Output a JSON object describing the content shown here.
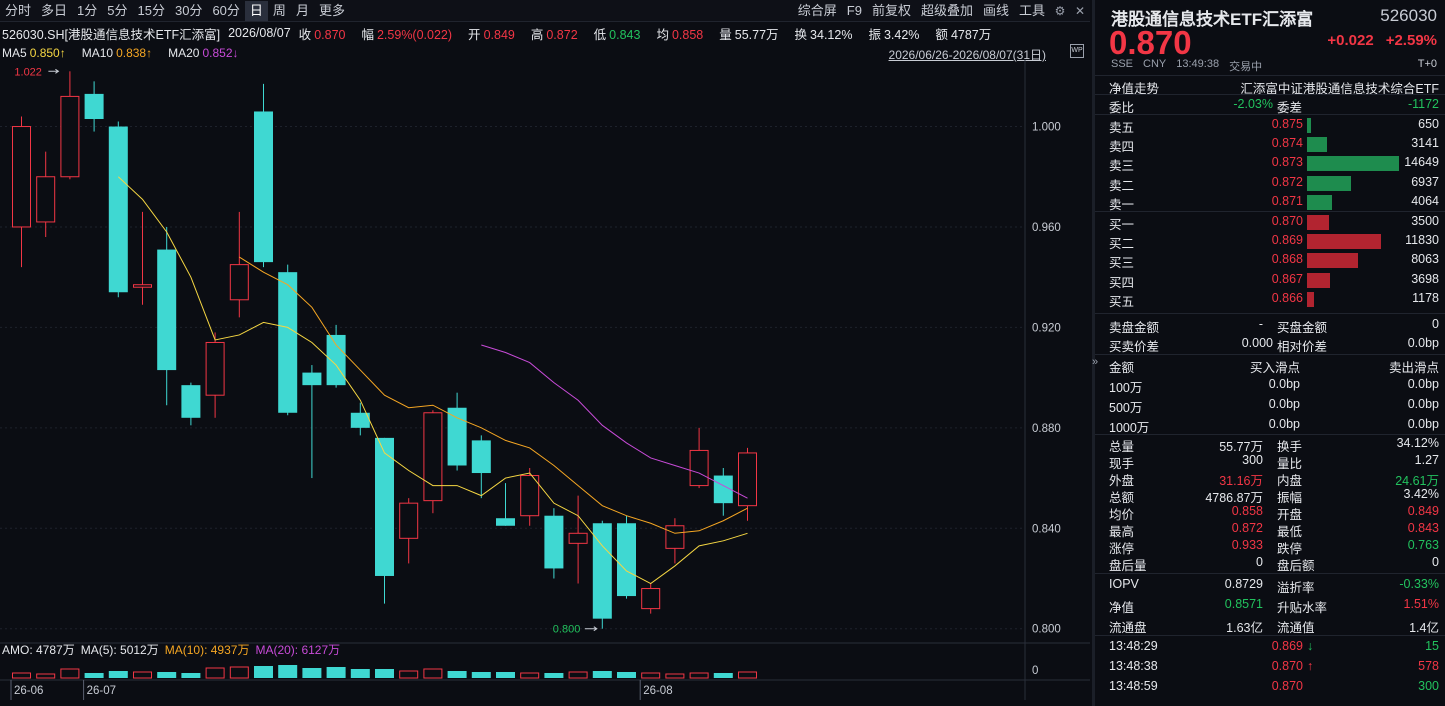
{
  "toolbar": {
    "periods": [
      "分时",
      "多日",
      "1分",
      "5分",
      "15分",
      "30分",
      "60分",
      "日",
      "周",
      "月",
      "更多"
    ],
    "active_index": 7,
    "right_items": [
      "综合屏",
      "F9",
      "前复权",
      "超级叠加",
      "画线",
      "工具"
    ]
  },
  "info": {
    "name": "526030.SH[港股通信息技术ETF汇添富]",
    "date": "2026/08/07",
    "close_label": "收",
    "close": "0.870",
    "range_label": "幅",
    "range": "2.59%(0.022)",
    "open_label": "开",
    "open": "0.849",
    "high_label": "高",
    "high": "0.872",
    "low_label": "低",
    "low": "0.843",
    "avg_label": "均",
    "avg": "0.858",
    "vol_label": "量",
    "vol": "55.77万",
    "turn_label": "换",
    "turn": "34.12%",
    "amp_label": "振",
    "amp": "3.42%",
    "amt_label": "额",
    "amt": "4787万"
  },
  "ma": {
    "ma5_label": "MA5",
    "ma5": "0.850↑",
    "ma10_label": "MA10",
    "ma10": "0.838↑",
    "ma20_label": "MA20",
    "ma20": "0.852↓"
  },
  "date_range": "2026/06/26-2026/08/07(31日)",
  "colors": {
    "up": "#f23645",
    "down": "#3fd8d2",
    "ma5": "#f6d743",
    "ma10": "#f5a623",
    "ma20": "#c84bd8",
    "bg": "#0b0d13",
    "grid": "#1e222c"
  },
  "chart_data": {
    "type": "candlestick",
    "y_ticks": [
      "1.000",
      "0.960",
      "0.920",
      "0.880",
      "0.840",
      "0.800"
    ],
    "y_tick_values": [
      1.0,
      0.96,
      0.92,
      0.88,
      0.84,
      0.8
    ],
    "ylim": [
      0.7955,
      1.0265
    ],
    "x_labels": [
      {
        "label": "26-06",
        "index": 0
      },
      {
        "label": "26-07",
        "index": 3
      },
      {
        "label": "26-08",
        "index": 26
      }
    ],
    "max_label": "1.022",
    "min_label": "0.800",
    "candles": [
      {
        "o": 0.96,
        "c": 1.0,
        "h": 1.004,
        "l": 0.944
      },
      {
        "o": 0.962,
        "c": 0.98,
        "h": 0.99,
        "l": 0.956
      },
      {
        "o": 0.98,
        "c": 1.012,
        "h": 1.022,
        "l": 0.979
      },
      {
        "o": 1.013,
        "c": 1.003,
        "h": 1.018,
        "l": 0.998
      },
      {
        "o": 1.0,
        "c": 0.934,
        "h": 1.002,
        "l": 0.932
      },
      {
        "o": 0.936,
        "c": 0.937,
        "h": 0.966,
        "l": 0.929
      },
      {
        "o": 0.951,
        "c": 0.903,
        "h": 0.96,
        "l": 0.889
      },
      {
        "o": 0.897,
        "c": 0.884,
        "h": 0.898,
        "l": 0.881
      },
      {
        "o": 0.893,
        "c": 0.914,
        "h": 0.918,
        "l": 0.884
      },
      {
        "o": 0.931,
        "c": 0.945,
        "h": 0.966,
        "l": 0.924
      },
      {
        "o": 1.006,
        "c": 0.946,
        "h": 1.017,
        "l": 0.944
      },
      {
        "o": 0.942,
        "c": 0.886,
        "h": 0.945,
        "l": 0.885
      },
      {
        "o": 0.902,
        "c": 0.897,
        "h": 0.905,
        "l": 0.86
      },
      {
        "o": 0.917,
        "c": 0.897,
        "h": 0.921,
        "l": 0.896
      },
      {
        "o": 0.886,
        "c": 0.88,
        "h": 0.89,
        "l": 0.877
      },
      {
        "o": 0.876,
        "c": 0.821,
        "h": 0.876,
        "l": 0.81
      },
      {
        "o": 0.836,
        "c": 0.85,
        "h": 0.852,
        "l": 0.826
      },
      {
        "o": 0.851,
        "c": 0.886,
        "h": 0.887,
        "l": 0.846
      },
      {
        "o": 0.888,
        "c": 0.865,
        "h": 0.894,
        "l": 0.863
      },
      {
        "o": 0.875,
        "c": 0.862,
        "h": 0.877,
        "l": 0.852
      },
      {
        "o": 0.844,
        "c": 0.841,
        "h": 0.858,
        "l": 0.841
      },
      {
        "o": 0.845,
        "c": 0.861,
        "h": 0.864,
        "l": 0.841
      },
      {
        "o": 0.845,
        "c": 0.824,
        "h": 0.848,
        "l": 0.82
      },
      {
        "o": 0.834,
        "c": 0.838,
        "h": 0.853,
        "l": 0.818
      },
      {
        "o": 0.842,
        "c": 0.804,
        "h": 0.843,
        "l": 0.8
      },
      {
        "o": 0.842,
        "c": 0.813,
        "h": 0.845,
        "l": 0.812
      },
      {
        "o": 0.808,
        "c": 0.816,
        "h": 0.818,
        "l": 0.806
      },
      {
        "o": 0.832,
        "c": 0.841,
        "h": 0.844,
        "l": 0.826
      },
      {
        "o": 0.857,
        "c": 0.871,
        "h": 0.88,
        "l": 0.856
      },
      {
        "o": 0.861,
        "c": 0.85,
        "h": 0.864,
        "l": 0.845
      },
      {
        "o": 0.849,
        "c": 0.87,
        "h": 0.872,
        "l": 0.843
      }
    ],
    "ma5": [
      null,
      null,
      null,
      null,
      0.98,
      0.971,
      0.958,
      0.94,
      0.915,
      0.917,
      0.922,
      0.92,
      0.914,
      0.905,
      0.891,
      0.87,
      0.863,
      0.857,
      0.857,
      0.853,
      0.86,
      0.862,
      0.85,
      0.845,
      0.833,
      0.823,
      0.818,
      0.825,
      0.833,
      0.835,
      0.838
    ],
    "ma10": [
      null,
      null,
      null,
      null,
      null,
      null,
      null,
      null,
      null,
      0.948,
      0.942,
      0.937,
      0.928,
      0.913,
      0.903,
      0.893,
      0.888,
      0.889,
      0.884,
      0.88,
      0.875,
      0.872,
      0.865,
      0.857,
      0.849,
      0.845,
      0.842,
      0.838,
      0.839,
      0.843,
      0.848
    ],
    "ma20": [
      null,
      null,
      null,
      null,
      null,
      null,
      null,
      null,
      null,
      null,
      null,
      null,
      null,
      null,
      null,
      null,
      null,
      null,
      null,
      0.913,
      0.91,
      0.906,
      0.898,
      0.891,
      0.881,
      0.874,
      0.868,
      0.865,
      0.862,
      0.857,
      0.852
    ],
    "volume": [
      0.25,
      0.2,
      0.45,
      0.25,
      0.35,
      0.3,
      0.3,
      0.25,
      0.5,
      0.55,
      0.6,
      0.65,
      0.5,
      0.55,
      0.45,
      0.45,
      0.35,
      0.45,
      0.35,
      0.3,
      0.3,
      0.25,
      0.25,
      0.3,
      0.35,
      0.3,
      0.25,
      0.2,
      0.25,
      0.25,
      0.3
    ]
  },
  "amo": {
    "label": "AMO: 4787万",
    "ma5": "MA(5): 5012万",
    "ma10": "MA(10): 4937万",
    "ma20": "MA(20): 6127万",
    "zero": "0"
  },
  "panel": {
    "title": "港股通信息技术ETF汇添富",
    "code": "526030",
    "price": "0.870",
    "change": "+0.022",
    "change_pct": "+2.59%",
    "exchange": "SSE",
    "currency": "CNY",
    "time": "13:49:38",
    "status": "交易中",
    "t0": "T+0",
    "nav_trend": "净值走势",
    "index_name": "汇添富中证港股通信息技术综合ETF",
    "webi_label": "委比",
    "webi": "-2.03%",
    "weicha_label": "委差",
    "weicha": "-1172",
    "asks": [
      {
        "label": "卖五",
        "price": "0.875",
        "vol": "650",
        "w": 0.044
      },
      {
        "label": "卖四",
        "price": "0.874",
        "vol": "3141",
        "w": 0.215
      },
      {
        "label": "卖三",
        "price": "0.873",
        "vol": "14649",
        "w": 1.0
      },
      {
        "label": "卖二",
        "price": "0.872",
        "vol": "6937",
        "w": 0.474
      },
      {
        "label": "卖一",
        "price": "0.871",
        "vol": "4064",
        "w": 0.277
      }
    ],
    "bids": [
      {
        "label": "买一",
        "price": "0.870",
        "vol": "3500",
        "w": 0.239
      },
      {
        "label": "买二",
        "price": "0.869",
        "vol": "11830",
        "w": 0.808
      },
      {
        "label": "买三",
        "price": "0.868",
        "vol": "8063",
        "w": 0.55
      },
      {
        "label": "买四",
        "price": "0.867",
        "vol": "3698",
        "w": 0.252
      },
      {
        "label": "买五",
        "price": "0.866",
        "vol": "1178",
        "w": 0.08
      }
    ],
    "sell_amt_label": "卖盘金额",
    "sell_amt": "-",
    "buy_amt_label": "买盘金额",
    "buy_amt": "0",
    "bidask_diff_label": "买卖价差",
    "bidask_diff": "0.000",
    "rel_diff_label": "相对价差",
    "rel_diff": "0.0bp",
    "slip_head": [
      "金额",
      "买入滑点",
      "卖出滑点"
    ],
    "slip_rows": [
      {
        "amt": "100万",
        "buy": "0.0bp",
        "sell": "0.0bp"
      },
      {
        "amt": "500万",
        "buy": "0.0bp",
        "sell": "0.0bp"
      },
      {
        "amt": "1000万",
        "buy": "0.0bp",
        "sell": "0.0bp"
      }
    ],
    "stats": [
      {
        "l1": "总量",
        "v1": "55.77万",
        "c1": "white",
        "l2": "换手",
        "v2": "34.12%",
        "c2": "white"
      },
      {
        "l1": "现手",
        "v1": "300",
        "c1": "white",
        "l2": "量比",
        "v2": "1.27",
        "c2": "white"
      },
      {
        "l1": "外盘",
        "v1": "31.16万",
        "c1": "red",
        "l2": "内盘",
        "v2": "24.61万",
        "c2": "green"
      },
      {
        "l1": "总额",
        "v1": "4786.87万",
        "c1": "white",
        "l2": "振幅",
        "v2": "3.42%",
        "c2": "white"
      },
      {
        "l1": "均价",
        "v1": "0.858",
        "c1": "red",
        "l2": "开盘",
        "v2": "0.849",
        "c2": "red"
      },
      {
        "l1": "最高",
        "v1": "0.872",
        "c1": "red",
        "l2": "最低",
        "v2": "0.843",
        "c2": "red"
      },
      {
        "l1": "涨停",
        "v1": "0.933",
        "c1": "red",
        "l2": "跌停",
        "v2": "0.763",
        "c2": "green"
      },
      {
        "l1": "盘后量",
        "v1": "0",
        "c1": "white",
        "l2": "盘后额",
        "v2": "0",
        "c2": "white"
      }
    ],
    "stats2": [
      {
        "l1": "IOPV",
        "v1": "0.8729",
        "c1": "white",
        "l2": "溢折率",
        "v2": "-0.33%",
        "c2": "green"
      },
      {
        "l1": "净值",
        "v1": "0.8571",
        "c1": "green",
        "l2": "升贴水率",
        "v2": "1.51%",
        "c2": "red"
      },
      {
        "l1": "流通盘",
        "v1": "1.63亿",
        "c1": "white",
        "l2": "流通值",
        "v2": "1.4亿",
        "c2": "white"
      }
    ],
    "ticks": [
      {
        "time": "13:48:29",
        "price": "0.869",
        "arrow": "↓",
        "vol": "15",
        "pc": "red",
        "ac": "green",
        "vc": "green"
      },
      {
        "time": "13:48:38",
        "price": "0.870",
        "arrow": "↑",
        "vol": "578",
        "pc": "red",
        "ac": "red",
        "vc": "red"
      },
      {
        "time": "13:48:59",
        "price": "0.870",
        "arrow": "",
        "vol": "300",
        "pc": "red",
        "ac": "red",
        "vc": "green"
      }
    ]
  }
}
